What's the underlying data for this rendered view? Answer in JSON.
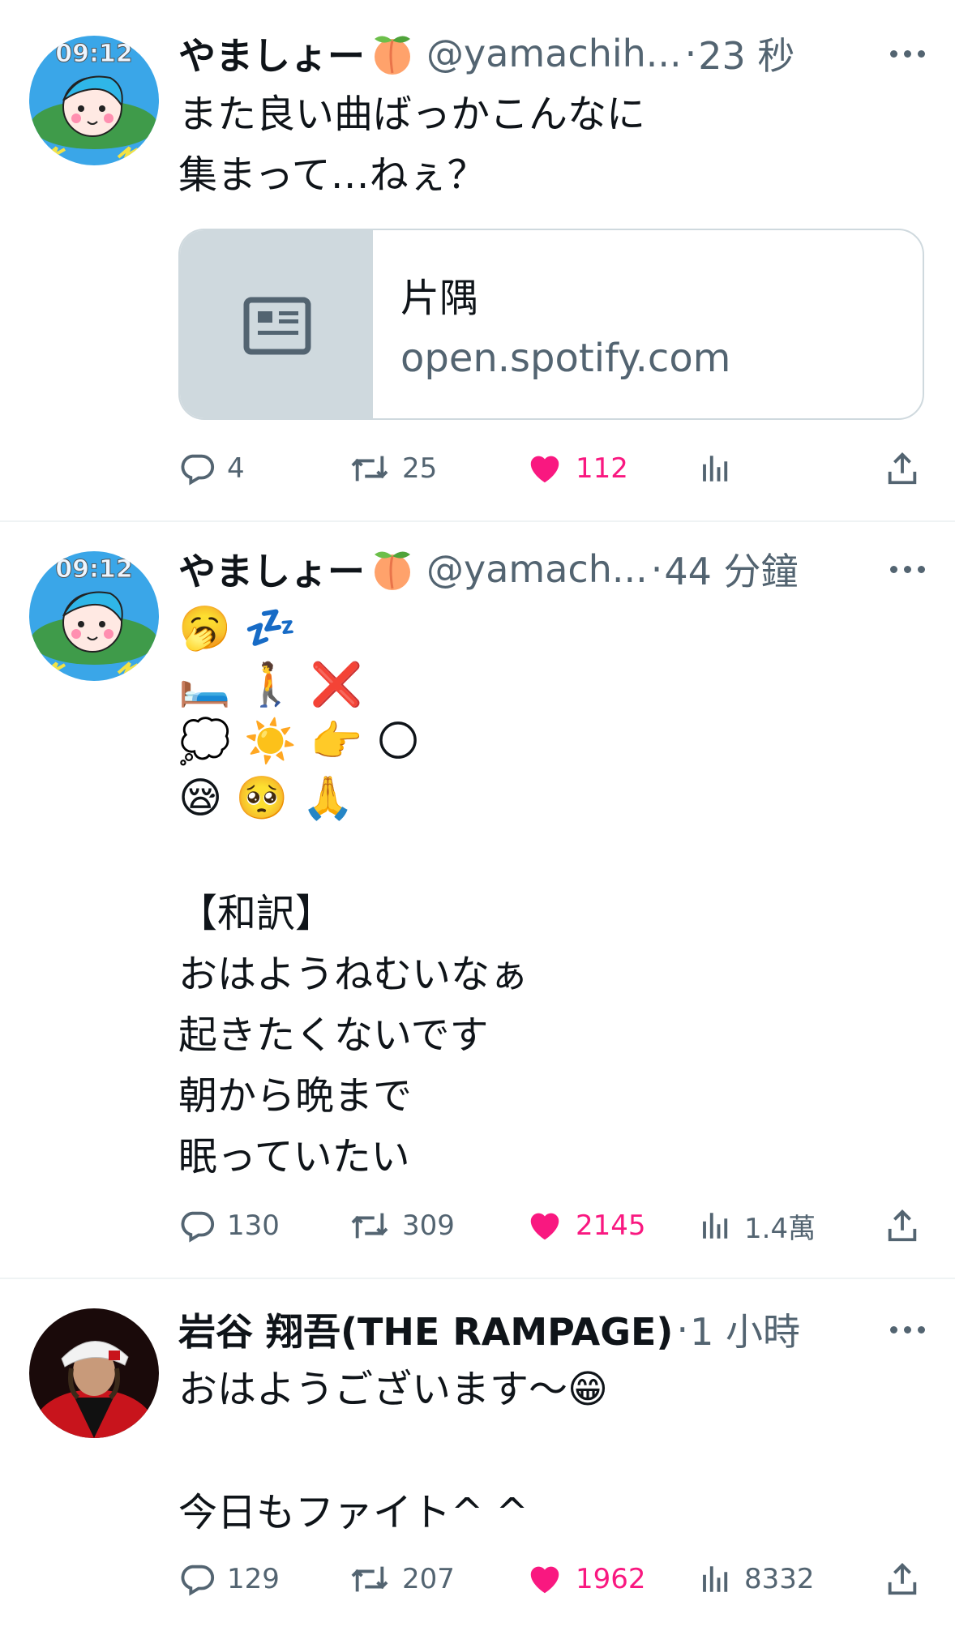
{
  "tweets": [
    {
      "name": "やましょー",
      "handle": "@yamachih...",
      "time": "23 秒",
      "text": "また良い曲ばっかこんなに\n集まって…ねぇ？",
      "card": {
        "title": "片隅",
        "domain": "open.spotify.com"
      },
      "replies": "4",
      "retweets": "25",
      "likes": "112",
      "views": ""
    },
    {
      "name": "やましょー",
      "handle": "@yamach...",
      "time": "44 分鐘",
      "emoji_lines": [
        "🥱 💤",
        "🛏️ 🚶 ❌",
        "💭 ☀️ 👉 🌕",
        "😪 🥺 🙏"
      ],
      "text": "【和訳】\nおはようねむいなぁ\n起きたくないです\n朝から晩まで\n眠っていたい",
      "replies": "130",
      "retweets": "309",
      "likes": "2145",
      "views": "1.4萬"
    },
    {
      "name": "岩谷 翔吾(THE RAMPAGE)",
      "handle": "",
      "time": "1 小時",
      "text": "おはようございます〜😁\n\n今日もファイト^ ^",
      "replies": "129",
      "retweets": "207",
      "likes": "1962",
      "views": "8332"
    }
  ],
  "colors": {
    "like": "#f91880",
    "secondary_text": "#536471",
    "divider": "#eff3f4",
    "card_border": "#cfd9de"
  },
  "icons": [
    "more-icon",
    "reply-icon",
    "retweet-icon",
    "like-icon",
    "views-icon",
    "share-icon",
    "article-icon"
  ]
}
